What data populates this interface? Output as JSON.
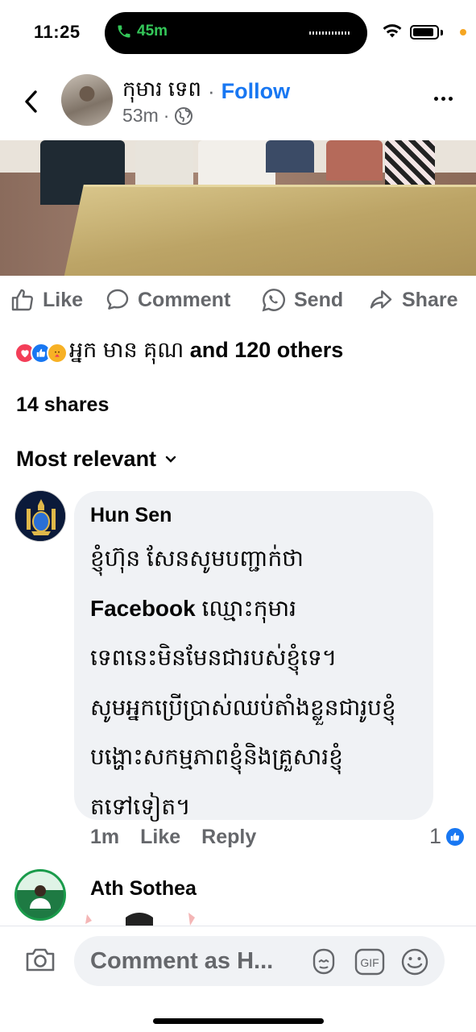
{
  "status_bar": {
    "time": "11:25",
    "call_duration": "45m"
  },
  "post": {
    "author_name": "កុមារ ទេព",
    "separator": "·",
    "follow_label": "Follow",
    "time_ago": "53m",
    "privacy_icon": "globe-icon"
  },
  "actions": {
    "like": "Like",
    "comment": "Comment",
    "send": "Send",
    "share": "Share"
  },
  "reactions": {
    "icons": [
      "love",
      "like",
      "care"
    ],
    "names": "អ្នក មាន គុណ",
    "others": "and 120 others"
  },
  "shares_text": "14 shares",
  "sort_label": "Most relevant",
  "comments": [
    {
      "name": "Hun Sen",
      "lines": [
        "ខ្ញុំហ៊ុន សែនសូមបញ្ជាក់ថា",
        "Facebook",
        " ឈ្មោះកុមារ",
        "ទេពនេះមិនមែនជារបស់ខ្ញុំទេ។",
        "សូមអ្នកប្រើប្រាស់ឈប់តាំងខ្លួនជារូបខ្ញុំ",
        "បង្ហោះសកម្មភាពខ្ញុំនិងគ្រួសារខ្ញុំ",
        "តទៅទៀត។"
      ],
      "time": "1m",
      "like_label": "Like",
      "reply_label": "Reply",
      "reaction_count": "1"
    },
    {
      "name": "Ath Sothea"
    }
  ],
  "composer": {
    "placeholder": "Comment as H..."
  },
  "colors": {
    "facebook_blue": "#1877f2",
    "secondary_text": "#65676b",
    "bubble_bg": "#f0f2f5",
    "call_green": "#34c759"
  }
}
